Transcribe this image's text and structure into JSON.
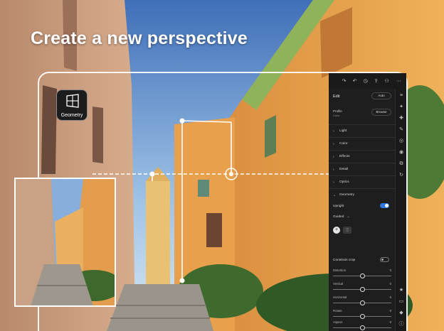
{
  "headline": "Create a new perspective",
  "badge": {
    "label": "Geometry",
    "icon": "perspective-grid-icon"
  },
  "panel": {
    "toolbar_icons": [
      "redo-icon",
      "undo-icon",
      "history-icon",
      "share-icon",
      "people-icon",
      "more-icon"
    ],
    "edit_title": "Edit",
    "auto_label": "Auto",
    "profile_label": "Profile",
    "profile_value": "Color",
    "browse_label": "Browse",
    "sections": [
      {
        "name": "Light"
      },
      {
        "name": "Color"
      },
      {
        "name": "Effects"
      },
      {
        "name": "Detail"
      },
      {
        "name": "Optics"
      },
      {
        "name": "Geometry"
      }
    ],
    "upright_label": "Upright",
    "upright_mode": "Guided",
    "constrain_label": "Constrain crop",
    "sliders": [
      {
        "name": "Distortion",
        "value": "0"
      },
      {
        "name": "Vertical",
        "value": "0"
      },
      {
        "name": "Horizontal",
        "value": "0"
      },
      {
        "name": "Rotate",
        "value": "0"
      },
      {
        "name": "Aspect",
        "value": "0"
      }
    ],
    "rail_icons": [
      "sliders-icon",
      "auto-icon",
      "heal-icon",
      "brush-icon",
      "mask-icon",
      "eye-icon",
      "presets-icon",
      "versions-icon",
      "star-icon",
      "comment-icon",
      "tag-icon",
      "info-icon"
    ]
  },
  "colors": {
    "accent": "#2f78e4",
    "panel_bg": "#1e1e1e",
    "wall": "#e3a24d"
  }
}
